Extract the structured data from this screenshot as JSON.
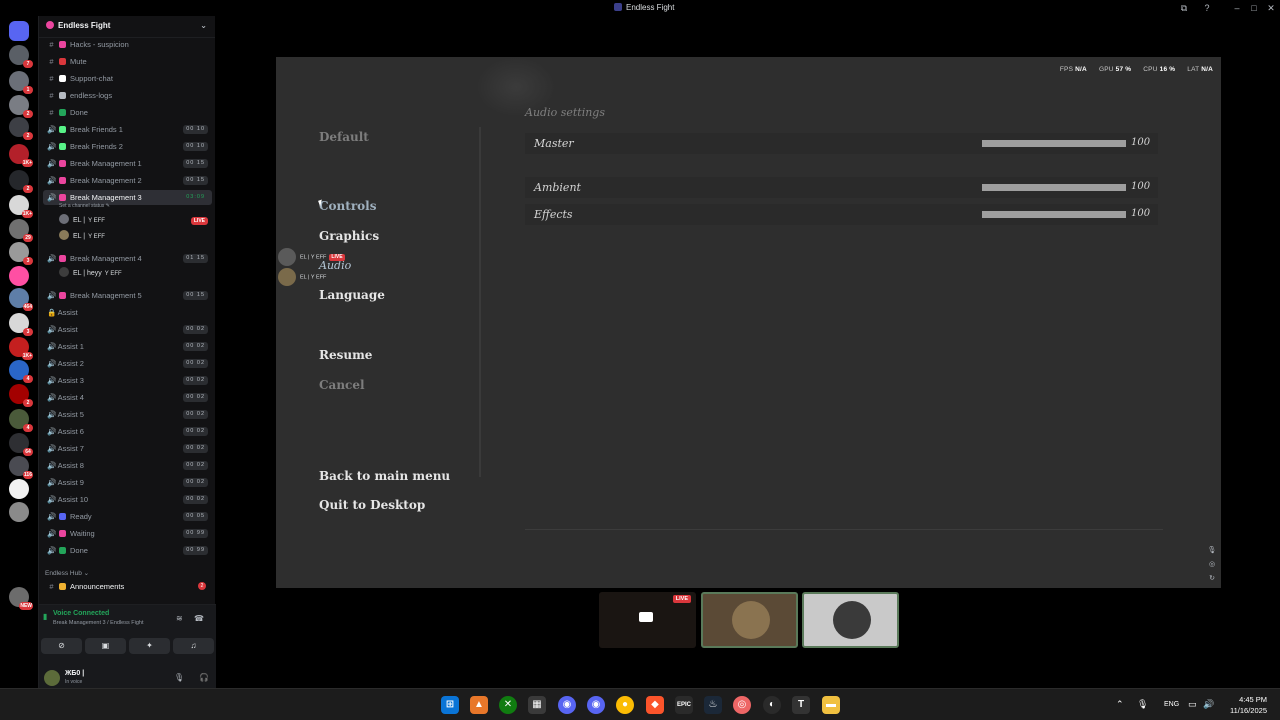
{
  "window": {
    "title": "Endless Fight",
    "controls": {
      "cast": "⧉",
      "help": "?",
      "minimize": "–",
      "maximize": "□",
      "close": "✕"
    }
  },
  "servers": [
    {
      "badge": "7",
      "color": "#5a5f66"
    },
    {
      "badge": "1",
      "color": "#6b6f78"
    },
    {
      "badge": "2",
      "color": "#7a7d84"
    },
    {
      "badge": "2",
      "color": "#3d3f45"
    },
    {
      "badge": "1K+",
      "color": "#b3202a"
    },
    {
      "badge": "2",
      "color": "#25272b"
    },
    {
      "badge": "1K+",
      "color": "#d8d8d8"
    },
    {
      "badge": "29",
      "color": "#707070"
    },
    {
      "badge": "3",
      "color": "#9a9a9a"
    },
    {
      "badge": "",
      "color": "#ff4fa3"
    },
    {
      "badge": "464",
      "color": "#5e7ea8"
    },
    {
      "badge": "3",
      "color": "#d8d8d8"
    },
    {
      "badge": "1K+",
      "color": "#c41f1f"
    },
    {
      "badge": "4",
      "color": "#2a66c8"
    },
    {
      "badge": "2",
      "color": "#a30000"
    },
    {
      "badge": "4",
      "color": "#4a5a3a"
    },
    {
      "badge": "64",
      "color": "#2e2f33"
    },
    {
      "badge": "116",
      "color": "#4a4b52"
    },
    {
      "badge": "",
      "color": "#f2f2f2"
    },
    {
      "badge": "",
      "color": "#8a8a8a"
    },
    {
      "badge": "NEW",
      "color": "#6c6c6c"
    }
  ],
  "sidebar": {
    "guild_name": "Endless Fight",
    "chevron": "⌄",
    "channels": [
      {
        "hash": "#",
        "label": "Hacks - suspicion",
        "emoji_color": "#eb459e"
      },
      {
        "hash": "#",
        "label": "Mute",
        "emoji_color": "#da373c"
      },
      {
        "hash": "#",
        "label": "Support-chat",
        "emoji_color": "#ffffff"
      },
      {
        "hash": "#",
        "label": "endless-logs",
        "emoji_color": "#b5bac1"
      },
      {
        "hash": "#",
        "label": "Done",
        "emoji_color": "#23a55a"
      },
      {
        "hash": "🔊",
        "label": "Break Friends 1",
        "emoji_color": "#57f287",
        "time": "00 10"
      },
      {
        "hash": "🔊",
        "label": "Break Friends 2",
        "emoji_color": "#57f287",
        "time": "00 10"
      },
      {
        "hash": "🔊",
        "label": "Break Management 1",
        "emoji_color": "#eb459e",
        "time": "00 15"
      },
      {
        "hash": "🔊",
        "label": "Break Management 2",
        "emoji_color": "#eb459e",
        "time": "00 15"
      },
      {
        "hash": "🔊",
        "label": "Break Management 3",
        "emoji_color": "#eb459e",
        "time": "03:09"
      }
    ],
    "active_subtitle": "Set a channel status ✎",
    "users_bm3": [
      {
        "name": "EL |",
        "tag": "Y EFF",
        "live": "LIVE"
      },
      {
        "name": "EL |",
        "tag": "Y EFF"
      }
    ],
    "channels_b": [
      {
        "hash": "🔊",
        "label": "Break Management 4",
        "emoji_color": "#eb459e",
        "time": "01 15"
      },
      {
        "hash": "🔊",
        "label": "Break Management 5",
        "emoji_color": "#eb459e",
        "time": "00 15"
      },
      {
        "hash": "🔒",
        "label": "Assist"
      },
      {
        "hash": "🔊",
        "label": "Assist",
        "time": "00 02"
      },
      {
        "hash": "🔊",
        "label": "Assist 1",
        "time": "00 02"
      },
      {
        "hash": "🔊",
        "label": "Assist 2",
        "time": "00 02"
      },
      {
        "hash": "🔊",
        "label": "Assist 3",
        "time": "00 02"
      },
      {
        "hash": "🔊",
        "label": "Assist 4",
        "time": "00 02"
      },
      {
        "hash": "🔊",
        "label": "Assist 5",
        "time": "00 02"
      },
      {
        "hash": "🔊",
        "label": "Assist 6",
        "time": "00 02"
      },
      {
        "hash": "🔊",
        "label": "Assist 7",
        "time": "00 02"
      },
      {
        "hash": "🔊",
        "label": "Assist 8",
        "time": "00 02"
      },
      {
        "hash": "🔊",
        "label": "Assist 9",
        "time": "00 02"
      },
      {
        "hash": "🔊",
        "label": "Assist 10",
        "time": "00 02"
      },
      {
        "hash": "🔊",
        "label": "Ready",
        "emoji_color": "#5865f2",
        "time": "00 05"
      },
      {
        "hash": "🔊",
        "label": "Waiting",
        "emoji_color": "#eb459e",
        "time": "00 99"
      },
      {
        "hash": "🔊",
        "label": "Done",
        "emoji_color": "#23a55a",
        "time": "00 99"
      }
    ],
    "user_bm4": {
      "name": "EL | heyy",
      "tag": "Y EFF"
    },
    "category": "Endless Hub ⌄",
    "announcements": {
      "hash": "#",
      "label": "Announcements",
      "count": "2"
    },
    "voice": {
      "status": "Voice Connected",
      "channel": "Break Management 3 / Endless Fight",
      "btn_camera": "⊘",
      "btn_share": "▣",
      "btn_activity": "✦",
      "btn_soundboard": "♫"
    },
    "user": {
      "name": "ЖБ0 |",
      "status": "In voice"
    }
  },
  "game": {
    "perf": {
      "fps_label": "FPS",
      "fps": "N/A",
      "gpu_label": "GPU",
      "gpu": "57 %",
      "cpu_label": "CPU",
      "cpu": "16 %",
      "lat_label": "LAT",
      "lat": "N/A"
    },
    "menu": {
      "default": "Default",
      "controls": "Controls",
      "graphics": "Graphics",
      "audio": "Audio",
      "language": "Language",
      "resume": "Resume",
      "cancel": "Cancel",
      "back": "Back to main menu",
      "quit": "Quit to Desktop"
    },
    "audio_title": "Audio settings",
    "settings": [
      {
        "label": "Master",
        "value": "100",
        "level": 1.0
      },
      {
        "label": "Ambient",
        "value": "100",
        "level": 1.0
      },
      {
        "label": "Effects",
        "value": "100",
        "level": 1.0
      }
    ],
    "overlay_users": [
      {
        "name": "EL |",
        "tag": "Y EFF",
        "live": "LIVE"
      },
      {
        "name": "EL |",
        "tag": "Y EFF"
      }
    ]
  },
  "tiles": [
    {
      "live": "LIVE",
      "color": "#1a1512"
    },
    {
      "color": "#5b4a36"
    },
    {
      "color": "#c9c9c9"
    }
  ],
  "taskbar": {
    "time": "4:45 PM",
    "date": "11/16/2025",
    "lang": "ENG"
  }
}
